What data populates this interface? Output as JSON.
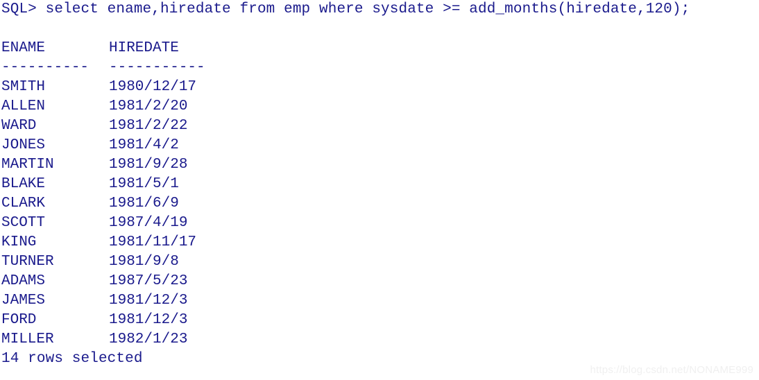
{
  "terminal": {
    "prompt": "SQL> ",
    "command": "select ename,hiredate from emp where sysdate >= add_months(hiredate,120);",
    "prompt_line": "SQL> select ename,hiredate from emp where sysdate >= add_months(hiredate,120);",
    "blank_line": " ",
    "header": {
      "ename": "ENAME",
      "hiredate": "HIREDATE"
    },
    "separator": {
      "ename": "----------",
      "hiredate": "-----------"
    },
    "rows": [
      {
        "ename": "SMITH",
        "hiredate": "1980/12/17"
      },
      {
        "ename": "ALLEN",
        "hiredate": "1981/2/20"
      },
      {
        "ename": "WARD",
        "hiredate": "1981/2/22"
      },
      {
        "ename": "JONES",
        "hiredate": "1981/4/2"
      },
      {
        "ename": "MARTIN",
        "hiredate": "1981/9/28"
      },
      {
        "ename": "BLAKE",
        "hiredate": "1981/5/1"
      },
      {
        "ename": "CLARK",
        "hiredate": "1981/6/9"
      },
      {
        "ename": "SCOTT",
        "hiredate": "1987/4/19"
      },
      {
        "ename": "KING",
        "hiredate": "1981/11/17"
      },
      {
        "ename": "TURNER",
        "hiredate": "1981/9/8"
      },
      {
        "ename": "ADAMS",
        "hiredate": "1987/5/23"
      },
      {
        "ename": "JAMES",
        "hiredate": "1981/12/3"
      },
      {
        "ename": "FORD",
        "hiredate": "1981/12/3"
      },
      {
        "ename": "MILLER",
        "hiredate": "1982/1/23"
      }
    ],
    "footer": "14 rows selected",
    "row_count": 14,
    "text_color": "#1a1a8c",
    "background_color": "#ffffff"
  },
  "watermark": {
    "text": "https://blog.csdn.net/NONAME999",
    "color": "#f0f0f0"
  }
}
